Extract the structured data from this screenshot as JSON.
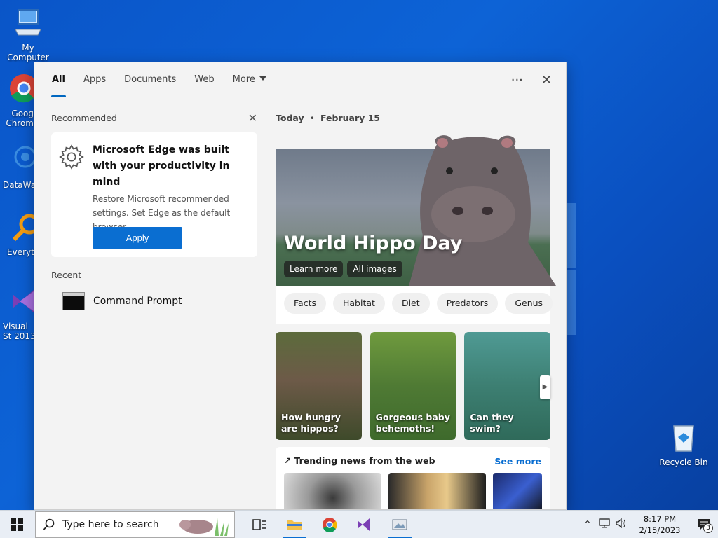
{
  "desktop": {
    "icons": [
      {
        "label": "My Computer",
        "icon": "computer-icon"
      },
      {
        "label": "Goog Chrom",
        "icon": "chrome-icon"
      },
      {
        "label": "DataWag",
        "icon": "datawag-icon"
      },
      {
        "label": "Everyth",
        "icon": "everything-icon"
      },
      {
        "label": "Visual St 2013",
        "icon": "visual-studio-icon"
      },
      {
        "label": "Recycle Bin",
        "icon": "recycle-bin-icon"
      }
    ]
  },
  "search_panel": {
    "tabs": [
      {
        "label": "All",
        "active": true
      },
      {
        "label": "Apps"
      },
      {
        "label": "Documents"
      },
      {
        "label": "Web"
      },
      {
        "label": "More"
      }
    ],
    "more_icon": "ellipsis-icon",
    "close_icon": "close-icon",
    "recommended": {
      "header": "Recommended",
      "title": "Microsoft Edge was built with your productivity in mind",
      "body": "Restore Microsoft recommended settings. Set Edge as the default browser.",
      "button": "Apply"
    },
    "recent": {
      "header": "Recent",
      "items": [
        {
          "label": "Command Prompt",
          "icon": "command-prompt-icon"
        }
      ]
    },
    "today": {
      "day": "Today",
      "separator": "•",
      "date": "February 15"
    },
    "hero": {
      "title": "World Hippo Day",
      "buttons": [
        "Learn more",
        "All images"
      ]
    },
    "chips": [
      "Facts",
      "Habitat",
      "Diet",
      "Predators",
      "Genus"
    ],
    "cards": [
      {
        "caption": "How hungry are hippos?"
      },
      {
        "caption": "Gorgeous baby behemoths!"
      },
      {
        "caption": "Can they swim?"
      }
    ],
    "trending": {
      "header": "Trending news from the web",
      "see_more": "See more"
    }
  },
  "taskbar": {
    "search_placeholder": "Type here to search",
    "clock_time": "8:17 PM",
    "clock_date": "2/15/2023",
    "notification_count": "3",
    "accent": "#0a6ed1"
  }
}
